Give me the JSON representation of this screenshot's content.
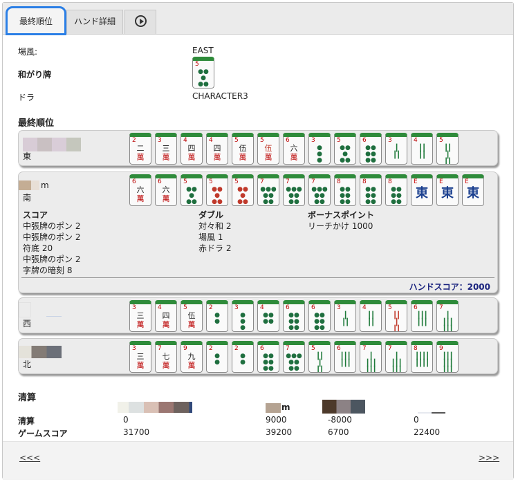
{
  "tabs": [
    {
      "label": "最終順位"
    },
    {
      "label": "ハンド詳細"
    },
    {
      "label": ""
    }
  ],
  "info": {
    "round_wind_label": "場風:",
    "round_wind_value": "EAST",
    "winning_tile_label": "和がり牌",
    "winning_tile": {
      "suit": "p",
      "num": "5"
    },
    "dora_label": "ドラ",
    "dora_value": "CHARACTER3"
  },
  "final_ranking_title": "最終順位",
  "players": [
    {
      "seat": "東",
      "name": "",
      "tiles": [
        {
          "suit": "m",
          "num": "2",
          "char": "二"
        },
        {
          "suit": "m",
          "num": "3",
          "char": "三"
        },
        {
          "suit": "m",
          "num": "4",
          "char": "四"
        },
        {
          "suit": "m",
          "num": "4",
          "char": "四"
        },
        {
          "suit": "m",
          "num": "5",
          "char": "伍"
        },
        {
          "suit": "m",
          "num": "5",
          "char": "伍",
          "red": true
        },
        {
          "suit": "m",
          "num": "6",
          "char": "六"
        },
        {
          "suit": "p",
          "num": "3"
        },
        {
          "suit": "p",
          "num": "5"
        },
        {
          "suit": "p",
          "num": "6"
        },
        {
          "suit": "s",
          "num": "3"
        },
        {
          "suit": "s",
          "num": "4"
        },
        {
          "suit": "s",
          "num": "5"
        }
      ]
    },
    {
      "seat": "南",
      "name": "m",
      "tiles": [
        {
          "suit": "m",
          "num": "6",
          "char": "六"
        },
        {
          "suit": "m",
          "num": "6",
          "char": "六"
        },
        {
          "suit": "p",
          "num": "5"
        },
        {
          "suit": "p",
          "num": "5",
          "red": true
        },
        {
          "suit": "p",
          "num": "5",
          "red": true
        },
        {
          "suit": "p",
          "num": "7"
        },
        {
          "suit": "p",
          "num": "7"
        },
        {
          "suit": "p",
          "num": "7"
        },
        {
          "suit": "p",
          "num": "8"
        },
        {
          "suit": "p",
          "num": "8"
        },
        {
          "suit": "p",
          "num": "8"
        },
        {
          "suit": "z",
          "num": "E",
          "char": "東"
        },
        {
          "suit": "z",
          "num": "E",
          "char": "東"
        },
        {
          "suit": "z",
          "num": "E",
          "char": "東"
        }
      ],
      "score_title": "スコア",
      "score_items": [
        "中張牌のポン 2",
        "中張牌のポン 2",
        "符底 20",
        "中張牌のポン 2",
        "字牌の暗刻 8"
      ],
      "double_title": "ダブル",
      "double_items": [
        "対々和 2",
        "場風 1",
        "赤ドラ 2"
      ],
      "bonus_title": "ボーナスポイント",
      "bonus_items": [
        "リーチかけ 1000"
      ],
      "hand_score": "ハンドスコア：2000"
    },
    {
      "seat": "西",
      "name": "",
      "tiles": [
        {
          "suit": "m",
          "num": "3",
          "char": "三"
        },
        {
          "suit": "m",
          "num": "4",
          "char": "四"
        },
        {
          "suit": "m",
          "num": "5",
          "char": "伍"
        },
        {
          "suit": "p",
          "num": "2"
        },
        {
          "suit": "p",
          "num": "3"
        },
        {
          "suit": "p",
          "num": "4"
        },
        {
          "suit": "p",
          "num": "6"
        },
        {
          "suit": "p",
          "num": "6"
        },
        {
          "suit": "s",
          "num": "3"
        },
        {
          "suit": "s",
          "num": "4"
        },
        {
          "suit": "s",
          "num": "5",
          "red": true
        },
        {
          "suit": "s",
          "num": "6"
        },
        {
          "suit": "s",
          "num": "7"
        }
      ]
    },
    {
      "seat": "北",
      "name": "",
      "tiles": [
        {
          "suit": "m",
          "num": "3",
          "char": "三"
        },
        {
          "suit": "m",
          "num": "7",
          "char": "七"
        },
        {
          "suit": "m",
          "num": "9",
          "char": "九"
        },
        {
          "suit": "p",
          "num": "2"
        },
        {
          "suit": "p",
          "num": "2"
        },
        {
          "suit": "p",
          "num": "6"
        },
        {
          "suit": "p",
          "num": "7"
        },
        {
          "suit": "s",
          "num": "5"
        },
        {
          "suit": "s",
          "num": "6"
        },
        {
          "suit": "s",
          "num": "7"
        },
        {
          "suit": "s",
          "num": "7"
        },
        {
          "suit": "s",
          "num": "8"
        },
        {
          "suit": "s",
          "num": "9"
        }
      ]
    }
  ],
  "settlement": {
    "title": "清算",
    "headers": [
      "",
      "m",
      "",
      ""
    ],
    "rows": [
      {
        "label": "清算",
        "values": [
          "0",
          "9000",
          "-8000",
          "0"
        ]
      },
      {
        "label": "ゲームスコア",
        "values": [
          "31700",
          "39200",
          "6700",
          "22400"
        ]
      }
    ]
  },
  "nav": {
    "prev": "<<<",
    "next": ">>>"
  },
  "colors": {
    "tile_back": "#2e8b3a",
    "active_tab": "#2b7fe6",
    "hand_score": "#1a237e"
  }
}
